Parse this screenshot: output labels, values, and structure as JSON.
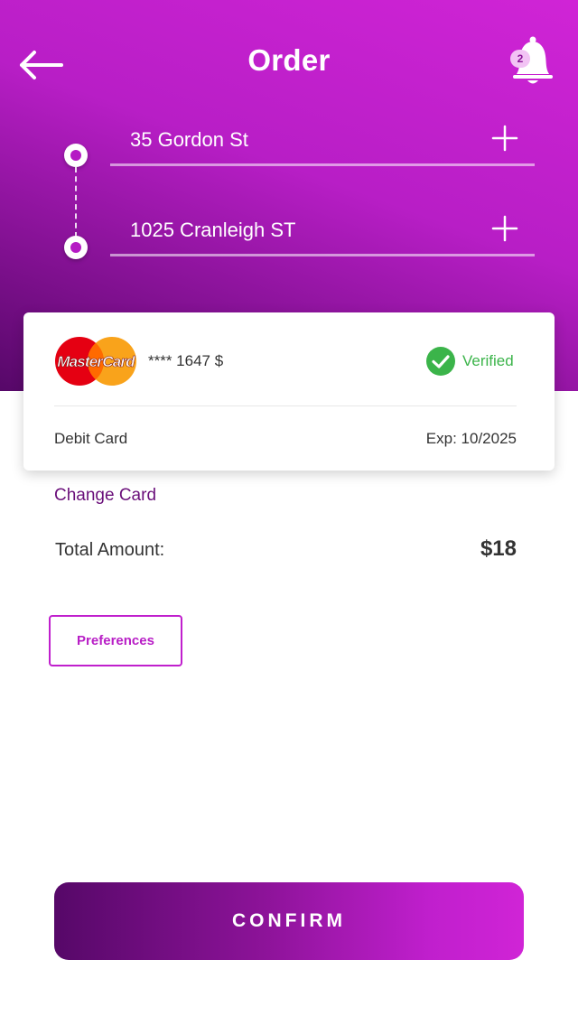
{
  "header": {
    "title": "Order",
    "back_icon": "arrow-left-icon",
    "notification_icon": "bell-icon",
    "notification_count": "2"
  },
  "route": {
    "from": "35 Gordon St",
    "to": "1025 Cranleigh ST",
    "add_icon": "plus-icon"
  },
  "card": {
    "brand": "MasterCard",
    "number": "**** 1647 $",
    "status": "Verified",
    "type": "Debit Card",
    "expiry": "Exp: 10/2025"
  },
  "payment": {
    "change_card_label": "Change Card",
    "total_label": "Total Amount:",
    "total_value": "$18"
  },
  "actions": {
    "preferences_label": "Preferences",
    "confirm_label": "CONFIRM"
  },
  "colors": {
    "accent": "#c01fcd",
    "accent_dark": "#560868",
    "verified": "#3bb44a"
  }
}
